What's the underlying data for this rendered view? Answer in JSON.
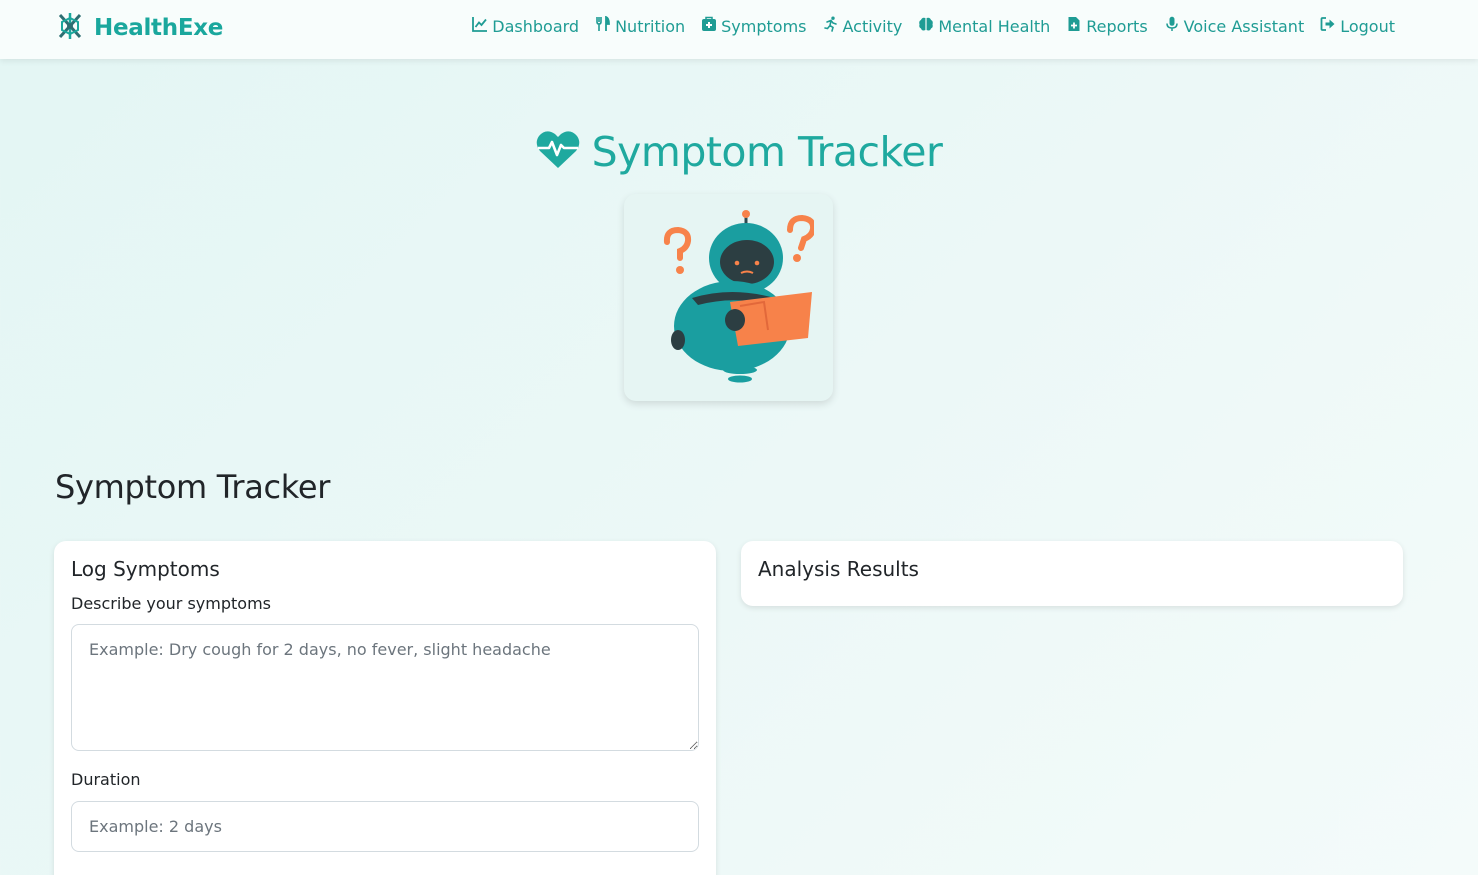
{
  "app": {
    "brand_name": "HealthExe"
  },
  "nav": {
    "items": [
      {
        "label": "Dashboard",
        "icon": "chart-line-icon"
      },
      {
        "label": "Nutrition",
        "icon": "utensils-icon"
      },
      {
        "label": "Symptoms",
        "icon": "medical-kit-icon"
      },
      {
        "label": "Activity",
        "icon": "running-icon"
      },
      {
        "label": "Mental Health",
        "icon": "brain-icon"
      },
      {
        "label": "Reports",
        "icon": "file-medical-icon"
      },
      {
        "label": "Voice Assistant",
        "icon": "microphone-icon"
      },
      {
        "label": "Logout",
        "icon": "logout-icon"
      }
    ]
  },
  "hero": {
    "title": "Symptom Tracker",
    "icon": "heart-pulse-icon",
    "illustration": "confused-robot-reading-illustration"
  },
  "section": {
    "title": "Symptom Tracker"
  },
  "log_card": {
    "title": "Log Symptoms",
    "symptoms_label": "Describe your symptoms",
    "symptoms_placeholder": "Example: Dry cough for 2 days, no fever, slight headache",
    "symptoms_value": "",
    "duration_label": "Duration",
    "duration_placeholder": "Example: 2 days",
    "duration_value": ""
  },
  "results_card": {
    "title": "Analysis Results"
  },
  "colors": {
    "brand": "#1aa79d",
    "nav_link": "#1f9c94",
    "robot_teal": "#1a9ea0",
    "robot_orange": "#f7824a"
  }
}
